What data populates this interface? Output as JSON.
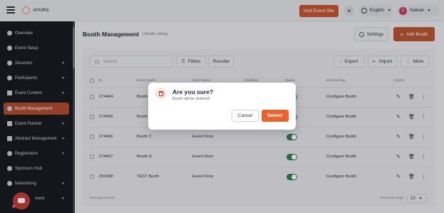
{
  "topbar": {
    "logo_text": "vFAIRS",
    "visit_label": "Visit Event Site",
    "language": "English",
    "user_initial": "S",
    "user_name": "Salman"
  },
  "sidebar": {
    "items": [
      {
        "label": "Overview"
      },
      {
        "label": "Event Setup"
      },
      {
        "label": "Sessions"
      },
      {
        "label": "Participants"
      },
      {
        "label": "Event Content"
      },
      {
        "label": "Booth Management"
      },
      {
        "label": "Event Planner"
      },
      {
        "label": "Abstract Management"
      },
      {
        "label": "Registration"
      },
      {
        "label": "Sponsors Hub"
      },
      {
        "label": "Networking"
      },
      {
        "label": "ment"
      }
    ]
  },
  "page": {
    "title": "Booth Management",
    "breadcrumb": "Booth Listing",
    "settings_label": "Settings",
    "add_label": "Add Booth"
  },
  "toolbar": {
    "search_placeholder": "Search",
    "filters_label": "Filters",
    "reorder_label": "Reorder",
    "export_label": "Export",
    "import_label": "Import",
    "more_label": "More"
  },
  "table": {
    "headers": [
      "ID",
      "Booth Name",
      "Floor Name",
      "Exhibitor",
      "Status",
      "Booth Setup",
      "Actions"
    ],
    "rows": [
      {
        "id": "274464",
        "name": "Booth",
        "floor": "",
        "setup": "Configure Booth"
      },
      {
        "id": "274465",
        "name": "Booth",
        "floor": "",
        "setup": "Configure Booth"
      },
      {
        "id": "274466",
        "name": "Booth C",
        "floor": "Event Floor",
        "setup": "Configure Booth"
      },
      {
        "id": "274467",
        "name": "Booth D",
        "floor": "Event Floor",
        "setup": "Configure Booth"
      },
      {
        "id": "291098",
        "name": "TEST Booth",
        "floor": "Event Floor",
        "setup": "Configure Booth"
      }
    ],
    "showing_text": "Showing 5 items",
    "per_page_label": "Items per page:",
    "per_page_value": "10"
  },
  "modal": {
    "title": "Are you sure?",
    "subtitle": "Booth will be deleted!",
    "cancel_label": "Cancel",
    "delete_label": "Delete!"
  },
  "colors": {
    "accent": "#e8632d",
    "sidebar_bg": "#14161c",
    "toggle_on": "#2e7d4d"
  }
}
